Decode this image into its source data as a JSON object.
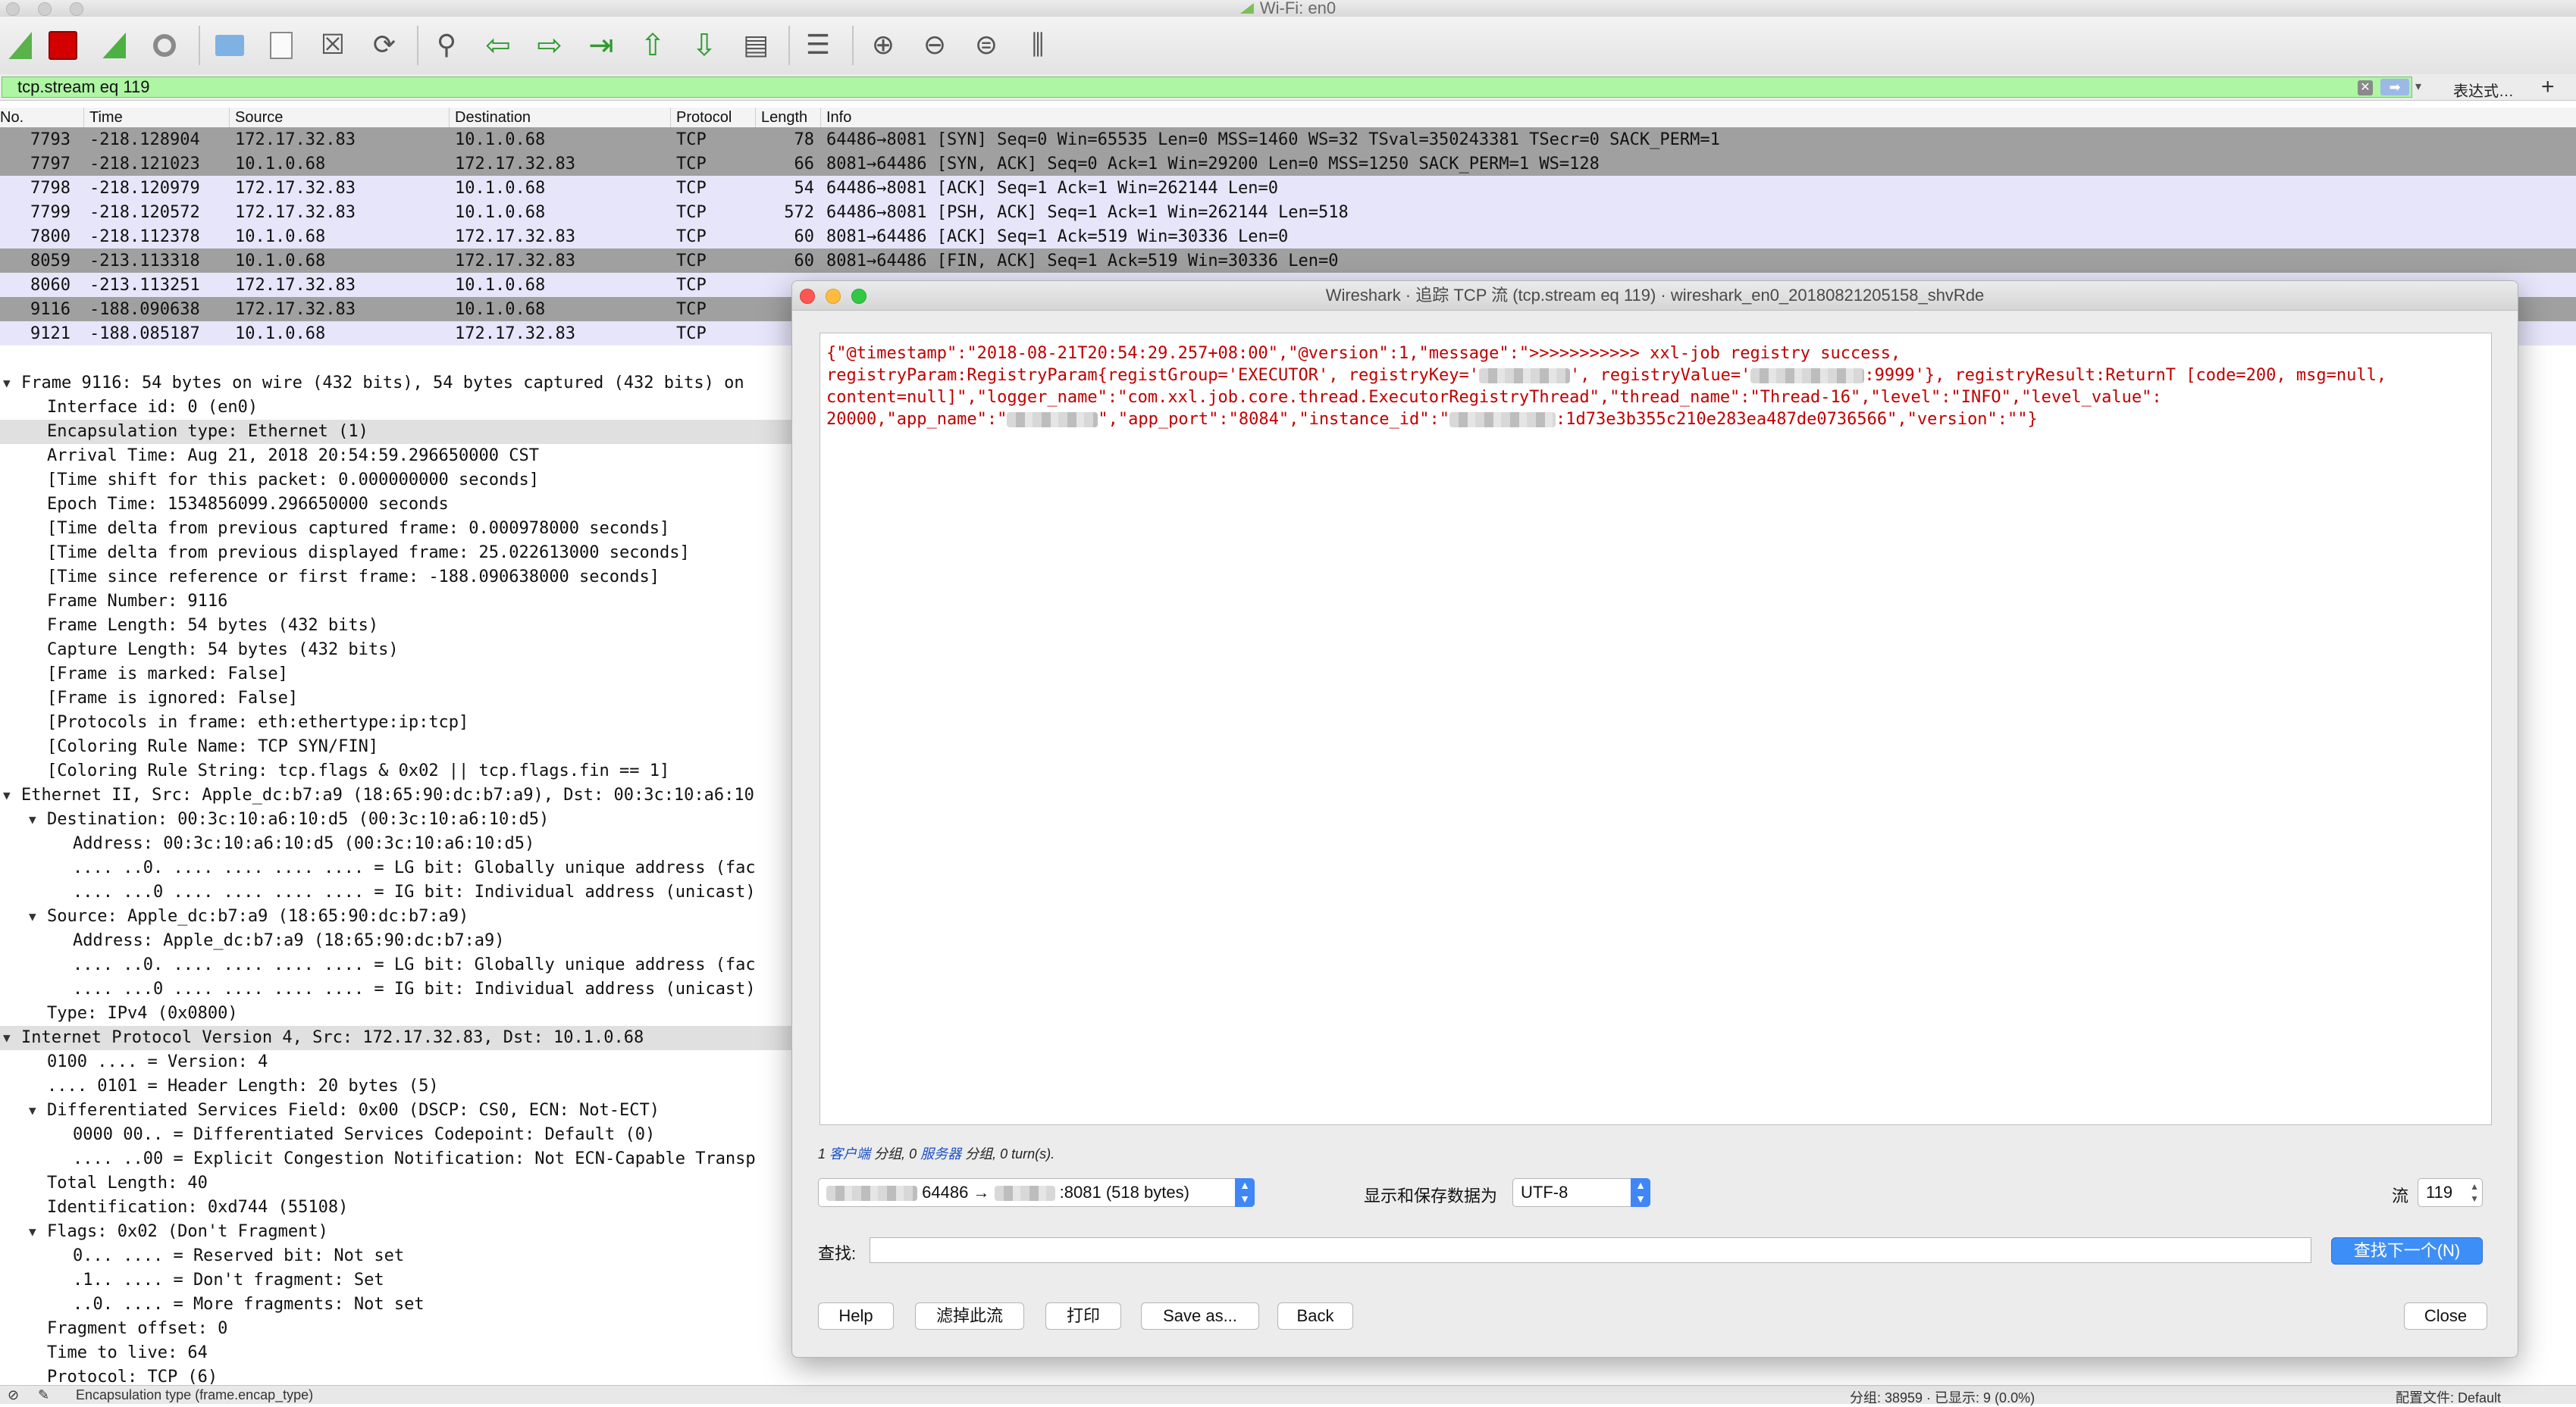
{
  "window": {
    "title": "Wi-Fi: en0"
  },
  "toolbar": {
    "icons": [
      "start-capture",
      "stop-capture",
      "restart-capture",
      "capture-options",
      "open-file",
      "save-file",
      "close-file",
      "reload-file",
      "find-packet",
      "go-back",
      "go-forward",
      "go-to-packet",
      "go-first",
      "go-last",
      "autoscroll",
      "colorize",
      "zoom-in",
      "zoom-out",
      "zoom-normal",
      "resize-columns"
    ]
  },
  "filter": {
    "value": "tcp.stream eq 119",
    "expression_label": "表达式…",
    "add_label": "+"
  },
  "packet_list": {
    "columns": [
      "No.",
      "Time",
      "Source",
      "Destination",
      "Protocol",
      "Length",
      "Info"
    ],
    "rows": [
      {
        "no": "7793",
        "time": "-218.128904",
        "src": "172.17.32.83",
        "dst": "10.1.0.68",
        "proto": "TCP",
        "len": "78",
        "info": "64486→8081 [SYN] Seq=0 Win=65535 Len=0 MSS=1460 WS=32 TSval=350243381 TSecr=0 SACK_PERM=1",
        "style": "dark"
      },
      {
        "no": "7797",
        "time": "-218.121023",
        "src": "10.1.0.68",
        "dst": "172.17.32.83",
        "proto": "TCP",
        "len": "66",
        "info": "8081→64486 [SYN, ACK] Seq=0 Ack=1 Win=29200 Len=0 MSS=1250 SACK_PERM=1 WS=128",
        "style": "dark"
      },
      {
        "no": "7798",
        "time": "-218.120979",
        "src": "172.17.32.83",
        "dst": "10.1.0.68",
        "proto": "TCP",
        "len": "54",
        "info": "64486→8081 [ACK] Seq=1 Ack=1 Win=262144 Len=0",
        "style": "light"
      },
      {
        "no": "7799",
        "time": "-218.120572",
        "src": "172.17.32.83",
        "dst": "10.1.0.68",
        "proto": "TCP",
        "len": "572",
        "info": "64486→8081 [PSH, ACK] Seq=1 Ack=1 Win=262144 Len=518",
        "style": "light"
      },
      {
        "no": "7800",
        "time": "-218.112378",
        "src": "10.1.0.68",
        "dst": "172.17.32.83",
        "proto": "TCP",
        "len": "60",
        "info": "8081→64486 [ACK] Seq=1 Ack=519 Win=30336 Len=0",
        "style": "light"
      },
      {
        "no": "8059",
        "time": "-213.113318",
        "src": "10.1.0.68",
        "dst": "172.17.32.83",
        "proto": "TCP",
        "len": "60",
        "info": "8081→64486 [FIN, ACK] Seq=1 Ack=519 Win=30336 Len=0",
        "style": "dark"
      },
      {
        "no": "8060",
        "time": "-213.113251",
        "src": "172.17.32.83",
        "dst": "10.1.0.68",
        "proto": "TCP",
        "len": "",
        "info": "",
        "style": "light"
      },
      {
        "no": "9116",
        "time": "-188.090638",
        "src": "172.17.32.83",
        "dst": "10.1.0.68",
        "proto": "TCP",
        "len": "",
        "info": "",
        "style": "dark"
      },
      {
        "no": "9121",
        "time": "-188.085187",
        "src": "10.1.0.68",
        "dst": "172.17.32.83",
        "proto": "TCP",
        "len": "",
        "info": "",
        "style": "light"
      }
    ]
  },
  "details": {
    "lines": [
      {
        "indent": 0,
        "twisty": "▼",
        "text": "Frame 9116: 54 bytes on wire (432 bits), 54 bytes captured (432 bits) on"
      },
      {
        "indent": 1,
        "twisty": "",
        "text": "Interface id: 0 (en0)"
      },
      {
        "indent": 1,
        "twisty": "",
        "text": "Encapsulation type: Ethernet (1)",
        "highlight": true
      },
      {
        "indent": 1,
        "twisty": "",
        "text": "Arrival Time: Aug 21, 2018 20:54:59.296650000 CST"
      },
      {
        "indent": 1,
        "twisty": "",
        "text": "[Time shift for this packet: 0.000000000 seconds]"
      },
      {
        "indent": 1,
        "twisty": "",
        "text": "Epoch Time: 1534856099.296650000 seconds"
      },
      {
        "indent": 1,
        "twisty": "",
        "text": "[Time delta from previous captured frame: 0.000978000 seconds]"
      },
      {
        "indent": 1,
        "twisty": "",
        "text": "[Time delta from previous displayed frame: 25.022613000 seconds]"
      },
      {
        "indent": 1,
        "twisty": "",
        "text": "[Time since reference or first frame: -188.090638000 seconds]"
      },
      {
        "indent": 1,
        "twisty": "",
        "text": "Frame Number: 9116"
      },
      {
        "indent": 1,
        "twisty": "",
        "text": "Frame Length: 54 bytes (432 bits)"
      },
      {
        "indent": 1,
        "twisty": "",
        "text": "Capture Length: 54 bytes (432 bits)"
      },
      {
        "indent": 1,
        "twisty": "",
        "text": "[Frame is marked: False]"
      },
      {
        "indent": 1,
        "twisty": "",
        "text": "[Frame is ignored: False]"
      },
      {
        "indent": 1,
        "twisty": "",
        "text": "[Protocols in frame: eth:ethertype:ip:tcp]"
      },
      {
        "indent": 1,
        "twisty": "",
        "text": "[Coloring Rule Name: TCP SYN/FIN]"
      },
      {
        "indent": 1,
        "twisty": "",
        "text": "[Coloring Rule String: tcp.flags & 0x02 || tcp.flags.fin == 1]"
      },
      {
        "indent": 0,
        "twisty": "▼",
        "text": "Ethernet II, Src: Apple_dc:b7:a9 (18:65:90:dc:b7:a9), Dst: 00:3c:10:a6:10"
      },
      {
        "indent": 1,
        "twisty": "▼",
        "text": "Destination: 00:3c:10:a6:10:d5 (00:3c:10:a6:10:d5)"
      },
      {
        "indent": 2,
        "twisty": "",
        "text": "Address: 00:3c:10:a6:10:d5 (00:3c:10:a6:10:d5)"
      },
      {
        "indent": 2,
        "twisty": "",
        "text": ".... ..0. .... .... .... .... = LG bit: Globally unique address (fac"
      },
      {
        "indent": 2,
        "twisty": "",
        "text": ".... ...0 .... .... .... .... = IG bit: Individual address (unicast)"
      },
      {
        "indent": 1,
        "twisty": "▼",
        "text": "Source: Apple_dc:b7:a9 (18:65:90:dc:b7:a9)"
      },
      {
        "indent": 2,
        "twisty": "",
        "text": "Address: Apple_dc:b7:a9 (18:65:90:dc:b7:a9)"
      },
      {
        "indent": 2,
        "twisty": "",
        "text": ".... ..0. .... .... .... .... = LG bit: Globally unique address (fac"
      },
      {
        "indent": 2,
        "twisty": "",
        "text": ".... ...0 .... .... .... .... = IG bit: Individual address (unicast)"
      },
      {
        "indent": 1,
        "twisty": "",
        "text": "Type: IPv4 (0x0800)"
      },
      {
        "indent": 0,
        "twisty": "▼",
        "text": "Internet Protocol Version 4, Src: 172.17.32.83, Dst: 10.1.0.68",
        "highlight": true
      },
      {
        "indent": 1,
        "twisty": "",
        "text": "0100 .... = Version: 4"
      },
      {
        "indent": 1,
        "twisty": "",
        "text": ".... 0101 = Header Length: 20 bytes (5)"
      },
      {
        "indent": 1,
        "twisty": "▼",
        "text": "Differentiated Services Field: 0x00 (DSCP: CS0, ECN: Not-ECT)"
      },
      {
        "indent": 2,
        "twisty": "",
        "text": "0000 00.. = Differentiated Services Codepoint: Default (0)"
      },
      {
        "indent": 2,
        "twisty": "",
        "text": ".... ..00 = Explicit Congestion Notification: Not ECN-Capable Transp"
      },
      {
        "indent": 1,
        "twisty": "",
        "text": "Total Length: 40"
      },
      {
        "indent": 1,
        "twisty": "",
        "text": "Identification: 0xd744 (55108)"
      },
      {
        "indent": 1,
        "twisty": "▼",
        "text": "Flags: 0x02 (Don't Fragment)"
      },
      {
        "indent": 2,
        "twisty": "",
        "text": "0... .... = Reserved bit: Not set"
      },
      {
        "indent": 2,
        "twisty": "",
        "text": ".1.. .... = Don't fragment: Set"
      },
      {
        "indent": 2,
        "twisty": "",
        "text": "..0. .... = More fragments: Not set"
      },
      {
        "indent": 1,
        "twisty": "",
        "text": "Fragment offset: 0"
      },
      {
        "indent": 1,
        "twisty": "",
        "text": "Time to live: 64"
      },
      {
        "indent": 1,
        "twisty": "",
        "text": "Protocol: TCP (6)"
      }
    ]
  },
  "statusbar": {
    "left": "Encapsulation type (frame.encap_type)",
    "middle": "分组: 38959 · 已显示: 9 (0.0%)",
    "right": "配置文件: Default"
  },
  "dialog": {
    "title": "Wireshark · 追踪 TCP 流 (tcp.stream eq 119) · wireshark_en0_20180821205158_shvRde",
    "stream_text": [
      "{\"@timestamp\":\"2018-08-21T20:54:29.257+08:00\",\"@version\":1,\"message\":\">>>>>>>>>>> xxl-job registry success,",
      "registryParam:RegistryParam{registGroup='EXECUTOR', registryKey='",
      "', registryValue='",
      ":9999'}, registryResult:ReturnT [code=200, msg=null,",
      "content=null]\",\"logger_name\":\"com.xxl.job.core.thread.ExecutorRegistryThread\",\"thread_name\":\"Thread-16\",\"level\":\"INFO\",\"level_value\":",
      "20000,\"app_name\":\"",
      "\",\"app_port\":\"8084\",\"instance_id\":\"",
      ":1d73e3b355c210e283ea487de0736566\",\"version\":\"\"}"
    ],
    "stats": {
      "client_count": "1",
      "client_label": "客户端",
      "packets_word": "分组,",
      "server_count": "0",
      "server_label": "服务器",
      "packets_word2": "分组,",
      "turns": "0 turn(s)."
    },
    "conversation_select": {
      "left_part": "64486 →",
      "right_part": ":8081 (518 bytes)"
    },
    "encoding_label": "显示和保存数据为",
    "encoding_value": "UTF-8",
    "stream_label": "流",
    "stream_value": "119",
    "find_label": "查找:",
    "find_value": "",
    "find_next": "查找下一个(N)",
    "buttons": {
      "help": "Help",
      "filter_out": "滤掉此流",
      "print": "打印",
      "save_as": "Save as...",
      "back": "Back",
      "close": "Close"
    }
  },
  "colors": {
    "filter_valid_bg": "#aef5a4",
    "row_dark": "#a0a0a0",
    "row_light": "#e6e5fa",
    "stream_text": "#c00000",
    "accent": "#3e8ef7"
  }
}
